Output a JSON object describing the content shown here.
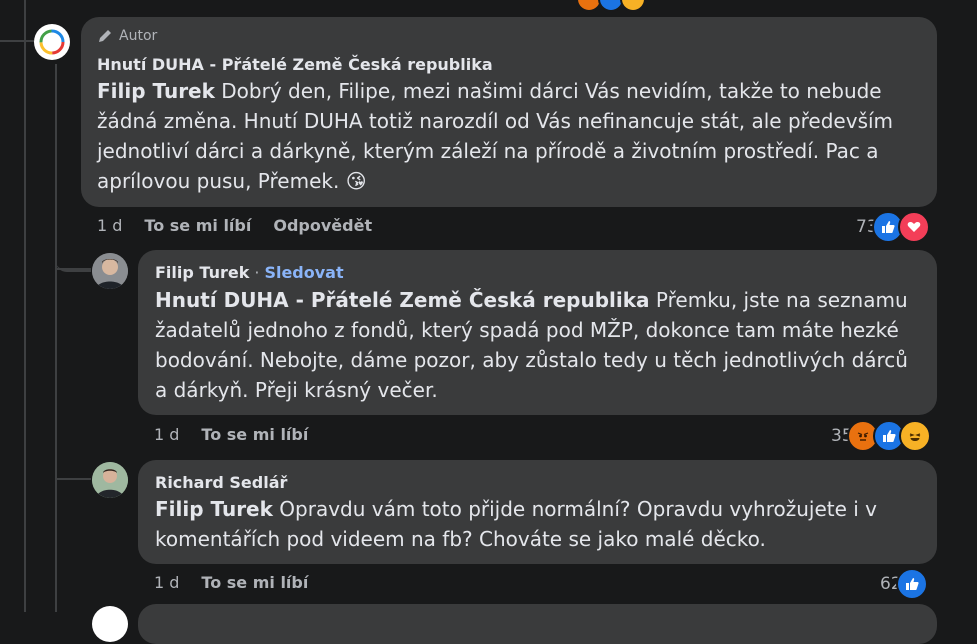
{
  "top_reaction_stub": {
    "colors": [
      "#e9710f",
      "#1b74e4",
      "#f7b125"
    ]
  },
  "comments": [
    {
      "badge": "Autor",
      "author": "Hnutí DUHA - Přátelé Země Česká republika",
      "mention": "Filip Turek",
      "text": "Dobrý den, Filipe, mezi našimi dárci Vás nevidím, takže to nebude žádná změna. Hnutí DUHA totiž narozdíl od Vás nefinancuje stát, ale především jednotliví dárci a dárkyně, kterým záleží na přírodě a životním prostředí. Pac a aprílovou pusu, Přemek. 😘",
      "time": "1 d",
      "like": "To se mi líbí",
      "reply": "Odpovědět",
      "reaction_count": "73",
      "reactions": [
        "like-icon",
        "love-icon"
      ]
    },
    {
      "author": "Filip Turek",
      "separator": "·",
      "follow": "Sledovat",
      "mention": "Hnutí DUHA - Přátelé Země Česká republika",
      "text": "Přemku, jste na seznamu žadatelů jednoho z fondů, který spadá pod MŽP, dokonce tam máte hezké bodování. Nebojte, dáme pozor, aby zůstalo tedy u těch jednotlivých dárců a dárkyň. Přeji krásný večer.",
      "time": "1 d",
      "like": "To se mi líbí",
      "reaction_count": "35",
      "reactions": [
        "angry-icon",
        "like-icon",
        "haha-icon"
      ]
    },
    {
      "author": "Richard Sedlář",
      "mention": "Filip Turek",
      "text": "Opravdu vám toto přijde normální? Opravdu vyhrožujete i v komentářích pod videem na fb? Chováte se jako malé děcko.",
      "time": "1 d",
      "like": "To se mi líbí",
      "reaction_count": "62",
      "reactions": [
        "like-icon"
      ]
    }
  ],
  "colors": {
    "like": "#1b74e4",
    "love": "#f33e58",
    "angry": "#e9710f",
    "haha": "#f7b125"
  }
}
